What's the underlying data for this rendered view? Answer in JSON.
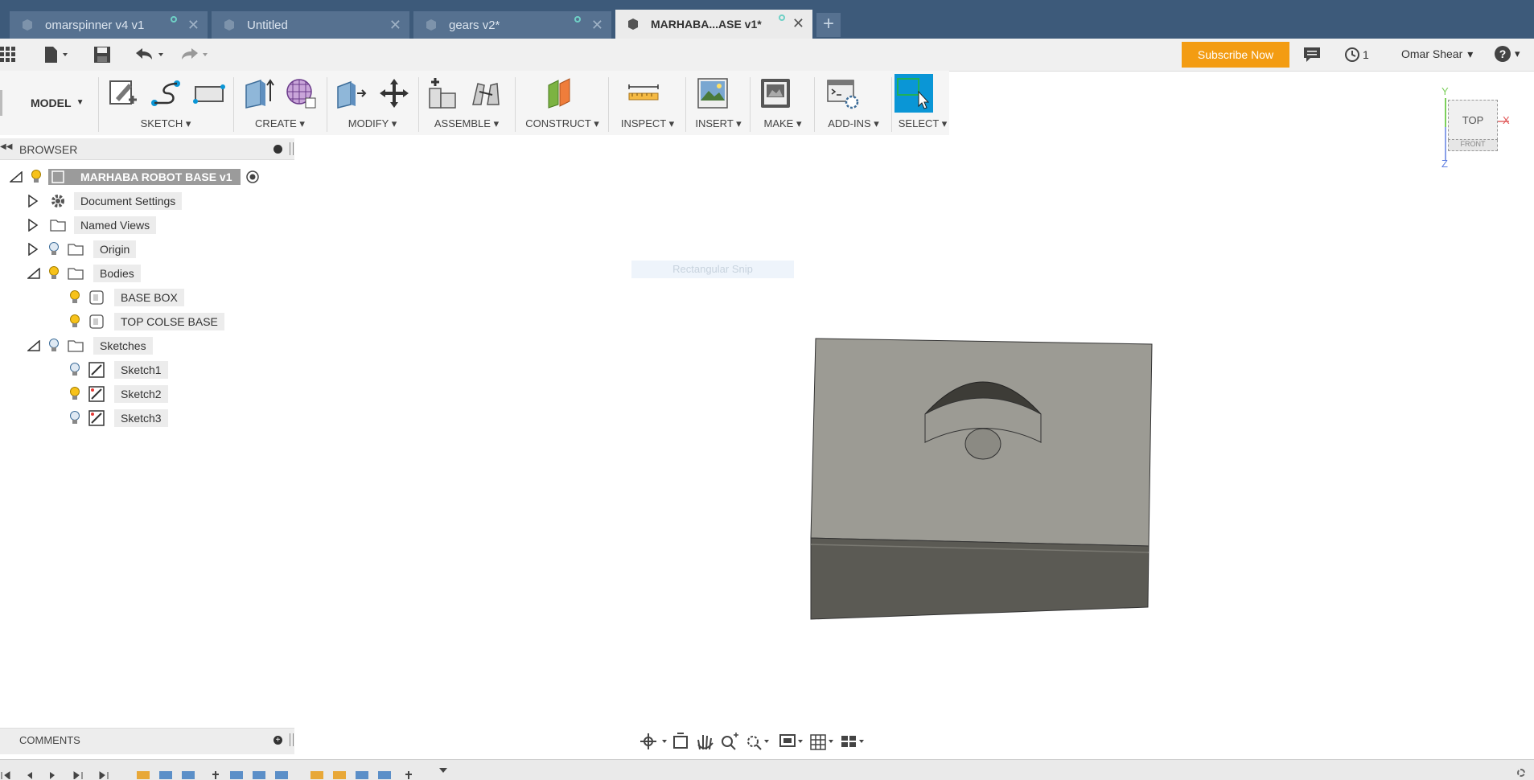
{
  "tabs": [
    {
      "label": "omarspinner v4 v1"
    },
    {
      "label": "Untitled"
    },
    {
      "label": "gears v2*"
    },
    {
      "label": "MARHABA...ASE v1*"
    }
  ],
  "header": {
    "subscribe": "Subscribe Now",
    "jobs_count": "1",
    "user": "Omar Shear",
    "user_caret": "▾",
    "help_caret": "▾"
  },
  "toolbar": {
    "workspace": "MODEL",
    "groups": [
      {
        "label": "SKETCH ▾"
      },
      {
        "label": "CREATE ▾"
      },
      {
        "label": "MODIFY ▾"
      },
      {
        "label": "ASSEMBLE ▾"
      },
      {
        "label": "CONSTRUCT ▾"
      },
      {
        "label": "INSPECT ▾"
      },
      {
        "label": "INSERT ▾"
      },
      {
        "label": "MAKE ▾"
      },
      {
        "label": "ADD-INS ▾"
      },
      {
        "label": "SELECT ▾"
      }
    ]
  },
  "browser": {
    "title": "BROWSER",
    "root": "MARHABA  ROBOT BASE v1",
    "items": [
      {
        "label": "Document Settings"
      },
      {
        "label": "Named Views"
      },
      {
        "label": "Origin"
      },
      {
        "label": "Bodies"
      },
      {
        "label": "BASE BOX"
      },
      {
        "label": "TOP COLSE BASE"
      },
      {
        "label": "Sketches"
      },
      {
        "label": "Sketch1"
      },
      {
        "label": "Sketch2"
      },
      {
        "label": "Sketch3"
      }
    ]
  },
  "canvas": {
    "snip_hint": "Rectangular Snip"
  },
  "viewcube": {
    "face": "TOP",
    "front": "FRONT",
    "axis_x": "X",
    "axis_y": "Y",
    "axis_z": "Z"
  },
  "comments": {
    "title": "COMMENTS"
  },
  "colors": {
    "tabbar": "#3d5a7a",
    "accent_select": "#0a96d6",
    "subscribe": "#f39c12",
    "model_top": "#9c9b94",
    "model_side": "#5b5a54"
  }
}
